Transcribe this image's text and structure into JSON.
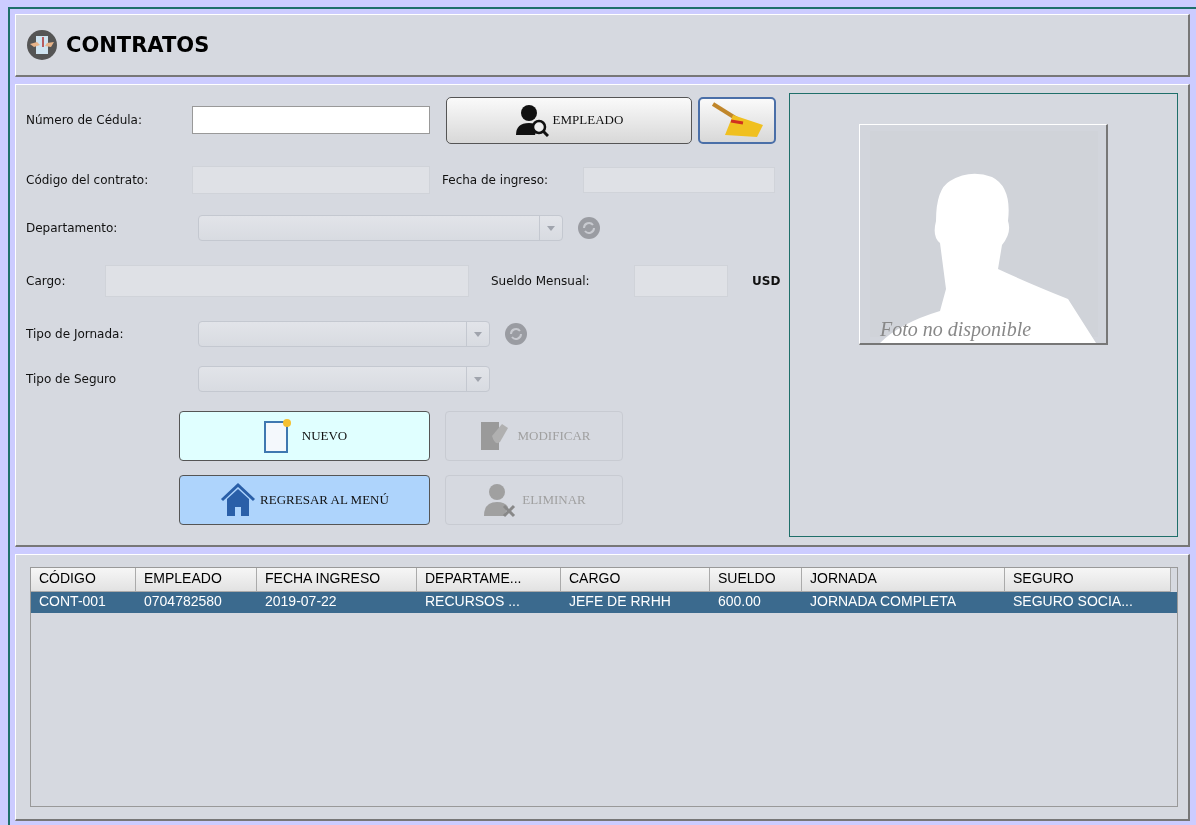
{
  "header": {
    "title": "CONTRATOS"
  },
  "form": {
    "cedula": {
      "label": "Número de Cédula:",
      "disabled": false
    },
    "search_button": {
      "label": "EMPLEADO"
    },
    "codigo": {
      "label": "Código del contrato:",
      "disabled": true
    },
    "fecha": {
      "label": "Fecha de ingreso:",
      "disabled": true
    },
    "departamento": {
      "label": "Departamento:",
      "disabled": true,
      "refresh": true
    },
    "cargo": {
      "label": "Cargo:",
      "disabled": true
    },
    "sueldo": {
      "label": "Sueldo Mensual:",
      "disabled": true,
      "unit": "USD"
    },
    "jornada": {
      "label": "Tipo de Jornada:",
      "disabled": true,
      "refresh": true
    },
    "seguro": {
      "label": "Tipo de Seguro",
      "disabled": true
    },
    "buttons": [
      {
        "kind": "new",
        "label": "NUEVO",
        "disabled": false
      },
      {
        "kind": "edit",
        "label": "MODIFICAR",
        "disabled": true
      },
      {
        "kind": "home",
        "label": "REGRESAR AL MENÚ",
        "disabled": false
      },
      {
        "kind": "delete",
        "label": "ELIMINAR",
        "disabled": true
      }
    ]
  },
  "photo": {
    "kind": "picture",
    "caption": "Foto no disponible"
  },
  "table": {
    "columns": [
      "CÓDIGO",
      "EMPLEADO",
      "FECHA INGRESO",
      "DEPARTAME...",
      "CARGO",
      "SUELDO",
      "JORNADA",
      "SEGURO"
    ],
    "rows": [
      {
        "selected": true,
        "cells": [
          "CONT-001",
          "0704782580",
          "2019-07-22",
          "RECURSOS ...",
          "JEFE DE RRHH",
          "600.00",
          "JORNADA COMPLETA",
          "SEGURO SOCIA..."
        ]
      }
    ]
  }
}
